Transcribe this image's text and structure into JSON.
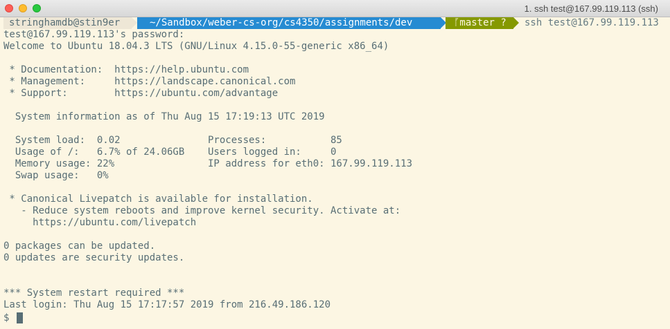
{
  "window": {
    "title": "1. ssh test@167.99.119.113 (ssh)"
  },
  "prompt": {
    "user_host": "stringhamdb@stin9er",
    "path": "~/Sandbox/weber-cs-org/cs4350/assignments/dev",
    "branch": "ᚵmaster ?",
    "command": "ssh test@167.99.119.113"
  },
  "output": {
    "l1": "test@167.99.119.113's password:",
    "l2": "Welcome to Ubuntu 18.04.3 LTS (GNU/Linux 4.15.0-55-generic x86_64)",
    "l3": " * Documentation:  https://help.ubuntu.com",
    "l4": " * Management:     https://landscape.canonical.com",
    "l5": " * Support:        https://ubuntu.com/advantage",
    "l6": "  System information as of Thu Aug 15 17:19:13 UTC 2019",
    "l7": "  System load:  0.02               Processes:           85",
    "l8": "  Usage of /:   6.7% of 24.06GB    Users logged in:     0",
    "l9": "  Memory usage: 22%                IP address for eth0: 167.99.119.113",
    "l10": "  Swap usage:   0%",
    "l11": " * Canonical Livepatch is available for installation.",
    "l12": "   - Reduce system reboots and improve kernel security. Activate at:",
    "l13": "     https://ubuntu.com/livepatch",
    "l14": "0 packages can be updated.",
    "l15": "0 updates are security updates.",
    "l16": "*** System restart required ***",
    "l17": "Last login: Thu Aug 15 17:17:57 2019 from 216.49.186.120",
    "l18": "$"
  }
}
